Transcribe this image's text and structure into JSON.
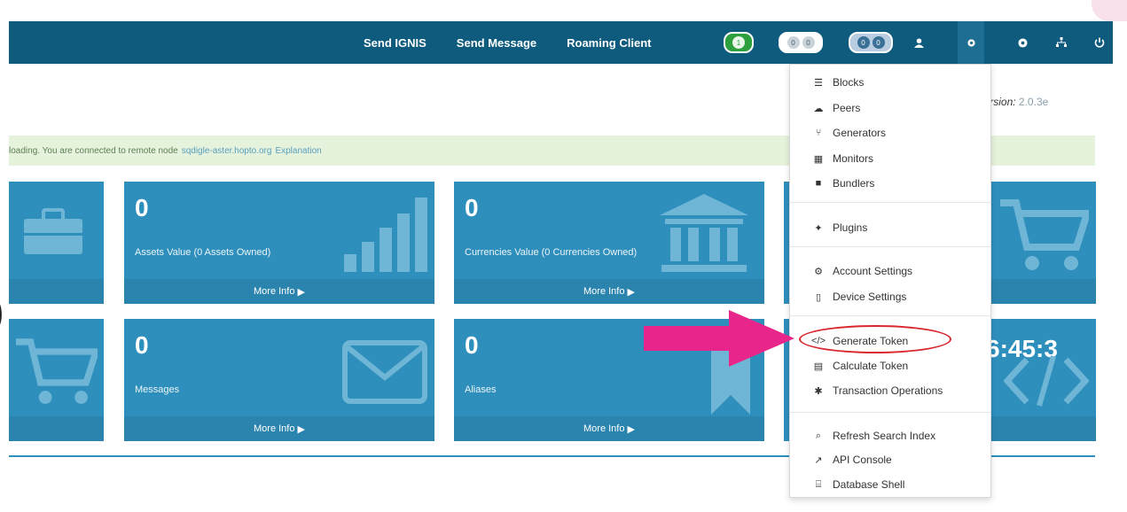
{
  "navbar": {
    "links": [
      "Send IGNIS",
      "Send Message",
      "Roaming Client"
    ],
    "pill_green": "1",
    "pill_grey": [
      "0",
      "0"
    ],
    "pill_blue": [
      "0",
      "0"
    ]
  },
  "version": {
    "label": "Version:",
    "number": "2.0.3e"
  },
  "alert": {
    "text": "loading. You are connected to remote node",
    "node": "sqdigle-aster.hopto.org",
    "explain": "Explanation"
  },
  "tiles": {
    "assets": {
      "num": "0",
      "label": "Assets Value (0 Assets Owned)",
      "more": "More Info"
    },
    "currencies": {
      "num": "0",
      "label": "Currencies Value (0 Currencies Owned)",
      "more": "More Info"
    },
    "messages": {
      "num": "0",
      "label": "Messages",
      "more": "More Info"
    },
    "aliases": {
      "num": "0",
      "label": "Aliases",
      "more": "More Info"
    }
  },
  "clock": "6:45:3",
  "dropdown": {
    "items": [
      "Blocks",
      "Peers",
      "Generators",
      "Monitors",
      "Bundlers",
      "Plugins",
      "Account Settings",
      "Device Settings",
      "Generate Token",
      "Calculate Token",
      "Transaction Operations",
      "Refresh Search Index",
      "API Console",
      "Database Shell"
    ]
  },
  "colors": {
    "navbar": "#0f5b7e",
    "tile": "#2f8fbc",
    "alert_bg": "#e5f2dc",
    "annotation": "#e8258a"
  }
}
